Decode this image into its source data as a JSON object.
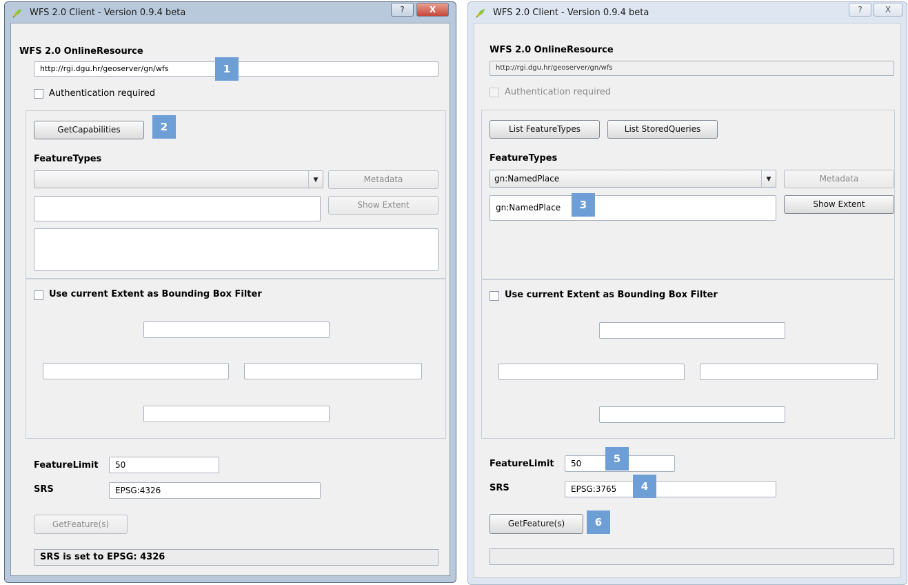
{
  "left": {
    "window_title": "WFS 2.0 Client - Version 0.9.4 beta",
    "help_label": "?",
    "close_label": "X",
    "online_resource_label": "WFS 2.0 OnlineResource",
    "url_value": "http://rgi.dgu.hr/geoserver/gn/wfs",
    "auth_label": "Authentication required",
    "getcapabilities_label": "GetCapabilities",
    "featuretypes_label": "FeatureTypes",
    "featuretype_selected": "",
    "metadata_label": "Metadata",
    "show_extent_label": "Show Extent",
    "bbox_filter_label": "Use current Extent as Bounding Box Filter",
    "featurelimit_label": "FeatureLimit",
    "featurelimit_value": "50",
    "srs_label": "SRS",
    "srs_value": "EPSG:4326",
    "getfeature_label": "GetFeature(s)",
    "status_text": "SRS is set to EPSG: 4326"
  },
  "right": {
    "window_title": "WFS 2.0 Client - Version 0.9.4 beta",
    "help_label": "?",
    "close_label": "X",
    "online_resource_label": "WFS 2.0 OnlineResource",
    "url_value": "http://rgi.dgu.hr/geoserver/gn/wfs",
    "auth_label": "Authentication required",
    "list_featuretypes_label": "List FeatureTypes",
    "list_storedqueries_label": "List StoredQueries",
    "featuretypes_label": "FeatureTypes",
    "featuretype_selected": "gn:NamedPlace",
    "featuretype_text": "gn:NamedPlace",
    "metadata_label": "Metadata",
    "show_extent_label": "Show Extent",
    "bbox_filter_label": "Use current Extent as Bounding Box Filter",
    "featurelimit_label": "FeatureLimit",
    "featurelimit_value": "50",
    "srs_label": "SRS",
    "srs_value": "EPSG:3765",
    "getfeature_label": "GetFeature(s)",
    "status_text": ""
  },
  "badges": [
    "1",
    "2",
    "3",
    "4",
    "5",
    "6"
  ],
  "colors": {
    "badge": "#6d9ed6",
    "close_button": "#c4483a"
  },
  "icons": {
    "app": "qgis-leaf-icon",
    "dropdown": "dropdown-arrow-icon"
  },
  "glyphs": {
    "dropdown_arrow": "▼"
  }
}
